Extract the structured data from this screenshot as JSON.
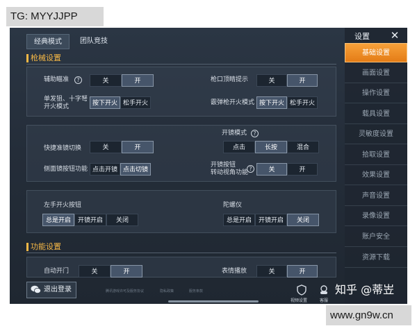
{
  "watermark_top": "TG: MYYJJPP",
  "watermark_bottom": "www.gn9w.cn",
  "tabs": [
    "经典模式",
    "团队竞技"
  ],
  "sections": {
    "firearm": "枪械设置",
    "function": "功能设置"
  },
  "settings": {
    "aim_assist": {
      "label": "辅助瞄准",
      "options": [
        "关",
        "开"
      ],
      "selected": "开"
    },
    "muzzle_hint": {
      "label": "枪口顶睛提示",
      "options": [
        "关",
        "开"
      ],
      "selected": "开"
    },
    "single_fire": {
      "label1": "单发狙、十字弩",
      "label2": "开火模式",
      "options": [
        "按下开火",
        "松手开火"
      ],
      "selected": "按下开火"
    },
    "shotgun_fire": {
      "label": "霰弹枪开火模式",
      "options": [
        "按下开火",
        "松手开火"
      ],
      "selected": "按下开火"
    },
    "quick_scope": {
      "label": "快捷准镜切换",
      "options": [
        "关",
        "开"
      ],
      "selected": "开"
    },
    "scope_mode": {
      "label": "开镜模式",
      "options": [
        "点击",
        "长按",
        "混合"
      ],
      "selected": "长按"
    },
    "side_scope": {
      "label": "侧面镜按钮功能",
      "options": [
        "点击开镜",
        "点击切镜"
      ],
      "selected": "点击切镜"
    },
    "scope_button": {
      "label1": "开镜按钮",
      "label2": "转动视角功能",
      "options": [
        "关",
        "开"
      ],
      "selected": "关"
    },
    "left_fire": {
      "label": "左手开火按钮",
      "options": [
        "总是开启",
        "开镜开启",
        "关闭"
      ],
      "selected": "总是开启"
    },
    "gyroscope": {
      "label": "陀螺仪",
      "options": [
        "总是开启",
        "开镜开启",
        "关闭"
      ],
      "selected": "关闭"
    },
    "auto_door": {
      "label": "自动开门",
      "options": [
        "关",
        "开"
      ],
      "selected": "开"
    },
    "emote": {
      "label": "表情播放",
      "options": [
        "关",
        "开"
      ],
      "selected": "开"
    }
  },
  "side_menu": {
    "title": "设置",
    "close": "✕",
    "items": [
      "基础设置",
      "画面设置",
      "操作设置",
      "载具设置",
      "灵敏度设置",
      "拾取设置",
      "效果设置",
      "声音设置",
      "录像设置",
      "账户安全",
      "资源下载"
    ],
    "active": "基础设置"
  },
  "footer": {
    "logout": "退出登录",
    "links": [
      "腾讯游戏许可及服务协议",
      "隐私政策",
      "服务条款"
    ],
    "privacy": "视频设置",
    "service": "客服",
    "zhihu": "知乎 @蒂岦"
  },
  "colors": {
    "accent": "#f6b846",
    "active_tab": "#e47c16"
  }
}
